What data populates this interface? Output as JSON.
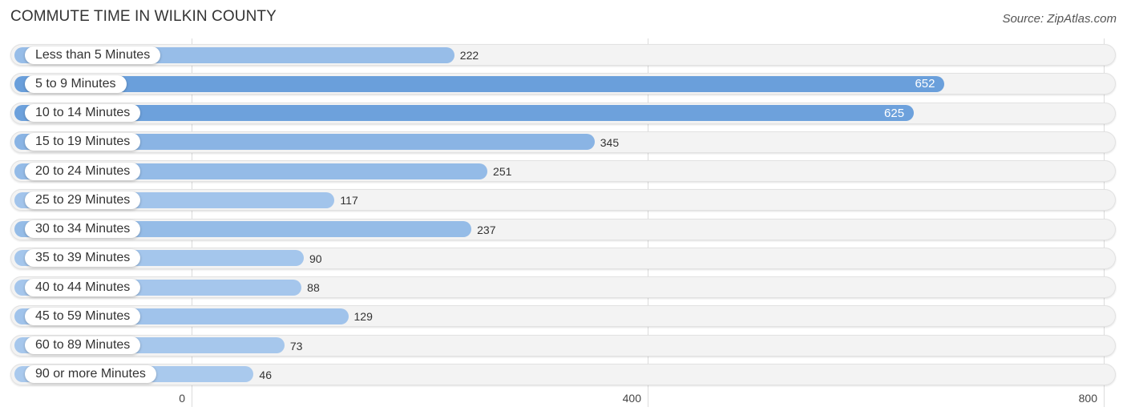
{
  "header": {
    "title": "COMMUTE TIME IN WILKIN COUNTY",
    "source": "Source: ZipAtlas.com"
  },
  "colors": {
    "bar_max": "#6a9fdb",
    "bar_min": "#a9c9ed",
    "track": "#f3f3f3",
    "label_bg": "#ffffff"
  },
  "chart_data": {
    "type": "bar",
    "orientation": "horizontal",
    "title": "COMMUTE TIME IN WILKIN COUNTY",
    "xlabel": "",
    "ylabel": "",
    "categories": [
      "Less than 5 Minutes",
      "5 to 9 Minutes",
      "10 to 14 Minutes",
      "15 to 19 Minutes",
      "20 to 24 Minutes",
      "25 to 29 Minutes",
      "30 to 34 Minutes",
      "35 to 39 Minutes",
      "40 to 44 Minutes",
      "45 to 59 Minutes",
      "60 to 89 Minutes",
      "90 or more Minutes"
    ],
    "values": [
      222,
      652,
      625,
      345,
      251,
      117,
      237,
      90,
      88,
      129,
      73,
      46
    ],
    "xlim": [
      0,
      800
    ],
    "xticks": [
      0,
      400,
      800
    ],
    "xtick_labels": [
      "0",
      "400",
      "800"
    ],
    "grid": true,
    "legend": "none"
  }
}
